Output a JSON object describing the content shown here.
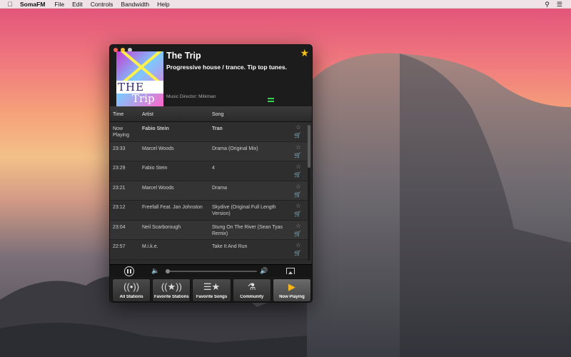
{
  "menubar": {
    "app_name": "SomaFM",
    "items": [
      "File",
      "Edit",
      "Controls",
      "Bandwidth",
      "Help"
    ]
  },
  "station": {
    "title": "The Trip",
    "description": "Progressive house / trance. Tip top tunes.",
    "director": "Music Director: Milkman",
    "art_text_1": "THE",
    "art_text_2": "Trip"
  },
  "columns": {
    "time": "Time",
    "artist": "Artist",
    "song": "Song"
  },
  "tracks": [
    {
      "time": "Now Playing",
      "artist": "Fabio Stein",
      "song": "Tran"
    },
    {
      "time": "23:33",
      "artist": "Marcel Woods",
      "song": "Drama (Original Mix)"
    },
    {
      "time": "23:29",
      "artist": "Fabio Stein",
      "song": "4"
    },
    {
      "time": "23:21",
      "artist": "Marcel Woods",
      "song": "Drama"
    },
    {
      "time": "23:12",
      "artist": "Freefall Feat. Jan Johnston",
      "song": "Skydive (Original Full Length Version)"
    },
    {
      "time": "23:04",
      "artist": "Neil Scarborough",
      "song": "Stung On The River (Sean Tyas Remix)"
    },
    {
      "time": "22:57",
      "artist": "M.i.k.e.",
      "song": "Take It And Run"
    }
  ],
  "player": {
    "volume_level": 0.0
  },
  "tabs": [
    {
      "label": "All Stations",
      "icon": "radio-waves-icon"
    },
    {
      "label": "Favorite Stations",
      "icon": "star-waves-icon"
    },
    {
      "label": "Favorite Songs",
      "icon": "star-list-icon"
    },
    {
      "label": "Community",
      "icon": "community-icon"
    },
    {
      "label": "Now Playing",
      "icon": "play-circle-icon"
    }
  ],
  "colors": {
    "accent_star": "#f4c21b",
    "eq_green": "#2dd84a",
    "now_playing": "#f5b417"
  }
}
